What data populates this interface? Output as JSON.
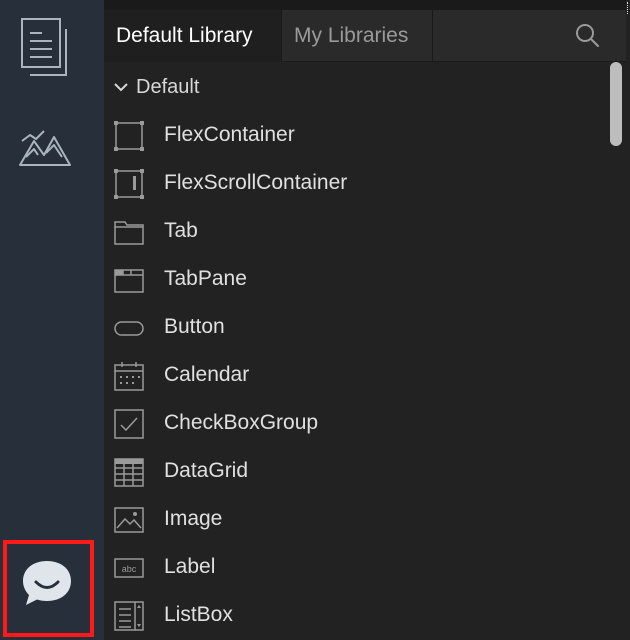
{
  "rail": {
    "items": [
      {
        "name": "pages",
        "icon": "pages-icon"
      },
      {
        "name": "assets",
        "icon": "mountain-icon"
      },
      {
        "name": "chat",
        "icon": "chat-bubble-icon"
      }
    ],
    "highlight_color": "#ff1a1a"
  },
  "tabs": [
    {
      "label": "Default Library",
      "active": true
    },
    {
      "label": "My Libraries",
      "active": false
    }
  ],
  "search": {
    "icon": "search-icon"
  },
  "section": {
    "label": "Default",
    "expanded": true
  },
  "widgets": [
    {
      "label": "FlexContainer",
      "icon": "flexcontainer-icon"
    },
    {
      "label": "FlexScrollContainer",
      "icon": "flexscrollcontainer-icon"
    },
    {
      "label": "Tab",
      "icon": "tab-icon"
    },
    {
      "label": "TabPane",
      "icon": "tabpane-icon"
    },
    {
      "label": "Button",
      "icon": "button-icon"
    },
    {
      "label": "Calendar",
      "icon": "calendar-icon"
    },
    {
      "label": "CheckBoxGroup",
      "icon": "checkbox-icon"
    },
    {
      "label": "DataGrid",
      "icon": "datagrid-icon"
    },
    {
      "label": "Image",
      "icon": "image-icon"
    },
    {
      "label": "Label",
      "icon": "label-icon",
      "icon_text": "abc"
    },
    {
      "label": "ListBox",
      "icon": "listbox-icon"
    }
  ],
  "colors": {
    "rail_bg": "#27303a",
    "panel_bg": "#222222",
    "active_tab_text": "#ffffff",
    "inactive_tab_text": "#9a9a9a"
  }
}
